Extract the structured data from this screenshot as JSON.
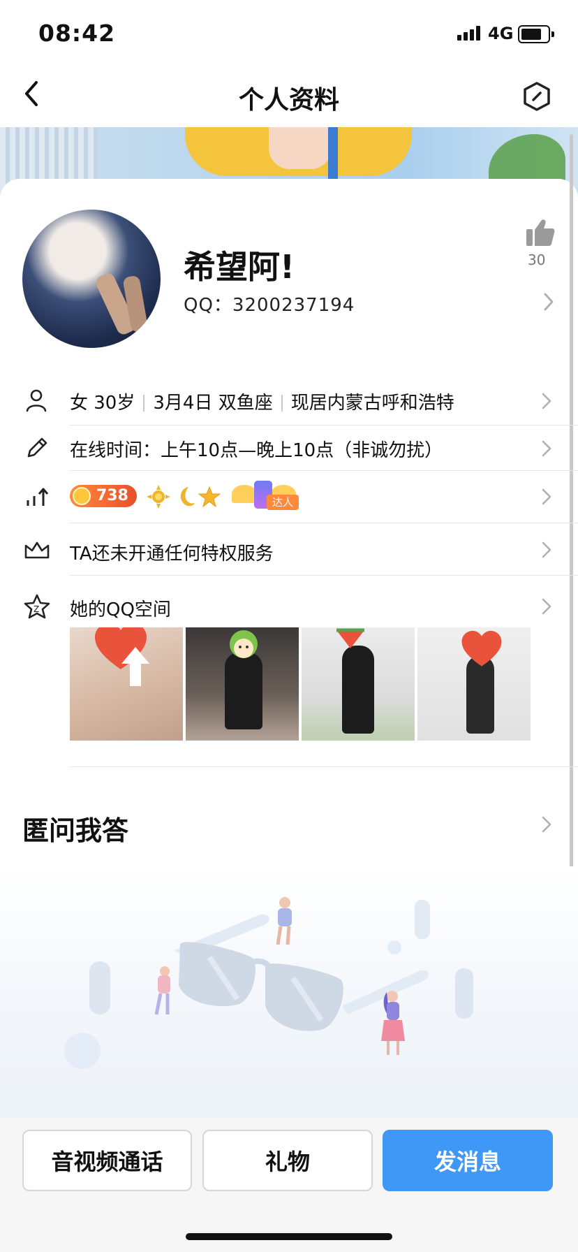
{
  "status_bar": {
    "time": "08:42",
    "network": "4G"
  },
  "nav": {
    "title": "个人资料",
    "back_icon": "chevron-left-icon",
    "settings_icon": "hexagon-edit-icon"
  },
  "profile": {
    "nickname": "希望阿!",
    "qq": "QQ：3200237194",
    "likes": "30"
  },
  "rows": {
    "info": {
      "gender_age": "女 30岁",
      "birthday": "3月4日 双鱼座",
      "location": "现居内蒙古呼和浩特"
    },
    "signature": "在线时间：上午10点—晚上10点（非诚勿扰）",
    "level": {
      "badge_value": "738",
      "daren_label": "达人"
    },
    "privilege": "TA还未开通任何特权服务",
    "qzone": "她的QQ空间"
  },
  "section": {
    "title": "匿问我答"
  },
  "bottom_buttons": {
    "call": "音视频通话",
    "gift": "礼物",
    "message": "发消息"
  },
  "colors": {
    "primary": "#3f98f6",
    "badge": "#e8502a"
  }
}
